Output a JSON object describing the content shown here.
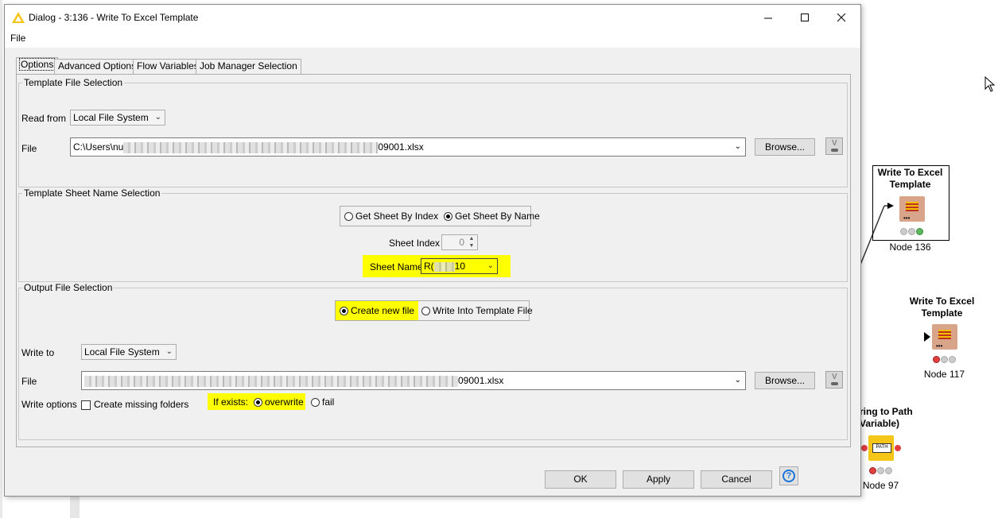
{
  "dialog": {
    "title": "Dialog - 3:136 - Write To Excel Template",
    "menu": [
      "File"
    ],
    "window_buttons": [
      "minimize",
      "maximize",
      "close"
    ],
    "tabs": [
      {
        "label": "Options",
        "active": true
      },
      {
        "label": "Advanced Options",
        "active": false
      },
      {
        "label": "Flow Variables",
        "active": false
      },
      {
        "label": "Job Manager Selection",
        "active": false
      }
    ],
    "template_file": {
      "legend": "Template File Selection",
      "read_from_label": "Read from",
      "read_from_value": "Local File System",
      "file_label": "File",
      "file_prefix": "C:\\Users\\nu",
      "file_suffix": "09001.xlsx",
      "browse_label": "Browse..."
    },
    "template_sheet": {
      "legend": "Template Sheet Name Selection",
      "option_by_index": "Get Sheet By Index",
      "option_by_name": "Get Sheet By Name",
      "selected": "by_name",
      "sheet_index_label": "Sheet Index",
      "sheet_index_value": "0",
      "sheet_name_label": "Sheet Name",
      "sheet_name_prefix": "R(",
      "sheet_name_suffix": "10"
    },
    "output_file": {
      "legend": "Output File Selection",
      "option_create": "Create new file",
      "option_write_into": "Write Into Template File",
      "selected": "create",
      "write_to_label": "Write to",
      "write_to_value": "Local File System",
      "file_label": "File",
      "file_suffix": "09001.xlsx",
      "browse_label": "Browse...",
      "write_options_label": "Write options",
      "create_missing_label": "Create missing folders",
      "if_exists_label": "If exists:",
      "overwrite_label": "overwrite",
      "fail_label": "fail",
      "if_exists_selected": "overwrite"
    },
    "buttons": {
      "ok": "OK",
      "apply": "Apply",
      "cancel": "Cancel",
      "help_icon": "?"
    }
  },
  "canvas": {
    "nodes": [
      {
        "title_line1": "Write To Excel",
        "title_line2": "Template",
        "label": "Node 136",
        "status": "green",
        "selected": true
      },
      {
        "title_line1": "Write To Excel",
        "title_line2": "Template",
        "label": "Node 117",
        "status": "red",
        "selected": false
      },
      {
        "title_line1": "ring to Path",
        "title_line2": "Variable)",
        "label": "Node 97",
        "status": "red",
        "selected": false
      }
    ]
  },
  "colors": {
    "highlight": "#ffff00",
    "dialog_bg": "#f0f0f0",
    "help_blue": "#1a73d9",
    "status_green": "#5cb85c",
    "status_red": "#e04040"
  }
}
